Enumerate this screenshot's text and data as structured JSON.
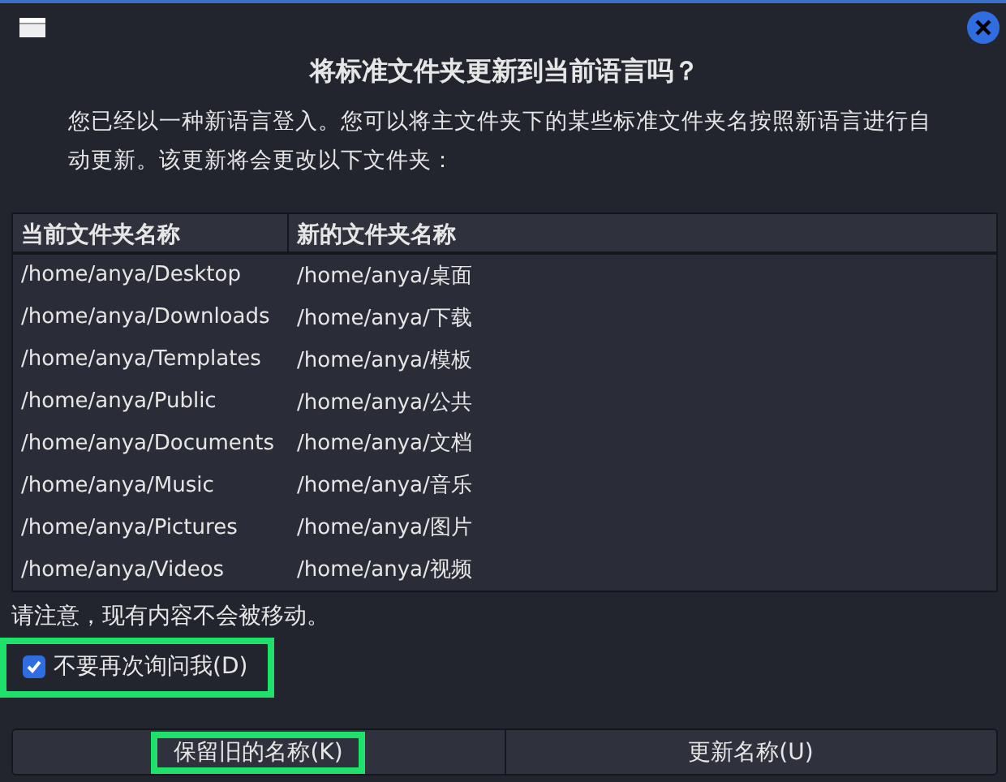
{
  "window": {
    "title": "将标准文件夹更新到当前语言吗？"
  },
  "description": "您已经以一种新语言登入。您可以将主文件夹下的某些标准文件夹名按照新语言进行自动更新。该更新将会更改以下文件夹：",
  "table": {
    "columns": [
      "当前文件夹名称",
      "新的文件夹名称"
    ],
    "rows": [
      [
        "/home/anya/Desktop",
        "/home/anya/桌面"
      ],
      [
        "/home/anya/Downloads",
        "/home/anya/下载"
      ],
      [
        "/home/anya/Templates",
        "/home/anya/模板"
      ],
      [
        "/home/anya/Public",
        "/home/anya/公共"
      ],
      [
        "/home/anya/Documents",
        "/home/anya/文档"
      ],
      [
        "/home/anya/Music",
        "/home/anya/音乐"
      ],
      [
        "/home/anya/Pictures",
        "/home/anya/图片"
      ],
      [
        "/home/anya/Videos",
        "/home/anya/视频"
      ]
    ]
  },
  "note": "请注意，现有内容不会被移动。",
  "checkbox": {
    "label": "不要再次询问我(D)",
    "checked": true,
    "highlighted": true
  },
  "buttons": [
    {
      "label": "保留旧的名称(K)",
      "highlighted": true
    },
    {
      "label": "更新名称(U)",
      "highlighted": false
    }
  ]
}
